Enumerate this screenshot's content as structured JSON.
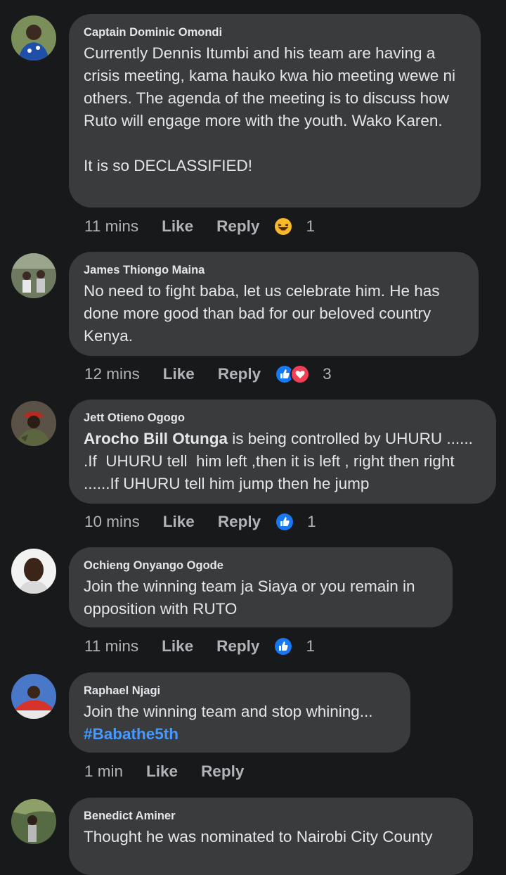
{
  "comments": [
    {
      "author": "Captain Dominic Omondi",
      "text": "Currently Dennis Itumbi and his team are having a crisis meeting, kama hauko kwa hio meeting wewe ni others. The agenda of the meeting is to discuss how Ruto will engage more with the youth. Wako Karen.\n\nIt is so DECLASSIFIED!",
      "time": "11 mins",
      "like": "Like",
      "reply": "Reply",
      "reactions": [
        "haha-icon"
      ],
      "count": "1"
    },
    {
      "author": "James Thiongo Maina",
      "text": "No need to fight baba, let us celebrate him. He has done more good than bad for our beloved country Kenya.",
      "time": "12 mins",
      "like": "Like",
      "reply": "Reply",
      "reactions": [
        "like-icon",
        "love-icon"
      ],
      "count": "3"
    },
    {
      "author": "Jett Otieno Ogogo",
      "mention": "Arocho Bill Otunga",
      "text": " is being controlled by UHURU ...... .If  UHURU tell  him left ,then it is left , right then right ......If UHURU tell him jump then he jump",
      "time": "10 mins",
      "like": "Like",
      "reply": "Reply",
      "reactions": [
        "like-icon"
      ],
      "count": "1"
    },
    {
      "author": "Ochieng Onyango Ogode",
      "text": "Join the winning team ja Siaya or you remain in opposition with RUTO",
      "time": "11 mins",
      "like": "Like",
      "reply": "Reply",
      "reactions": [
        "like-icon"
      ],
      "count": "1"
    },
    {
      "author": "Raphael Njagi",
      "text": "Join the winning team and stop whining...",
      "hashtag": "#Babathe5th",
      "time": "1 min",
      "like": "Like",
      "reply": "Reply"
    },
    {
      "author": "Benedict Aminer",
      "text": "Thought he was nominated to Nairobi City County"
    }
  ],
  "colors": {
    "background": "#18191a",
    "bubble": "#3a3b3c",
    "secondary_text": "#b0b3b8",
    "link": "#4599ff",
    "like_blue": "#1877f2",
    "love_red": "#f33e58",
    "haha_yellow": "#f7b928"
  }
}
